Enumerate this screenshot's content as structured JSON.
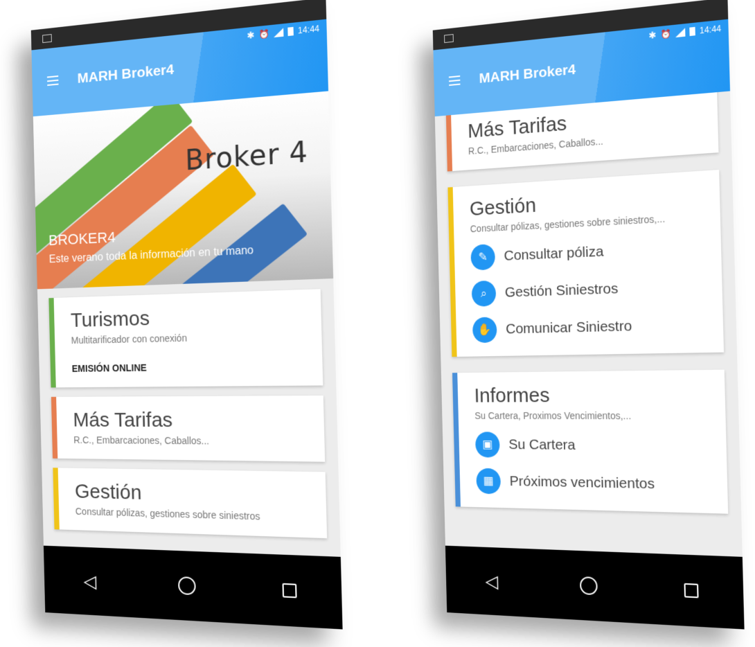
{
  "app": {
    "title": "MARH Broker4",
    "time": "14:44"
  },
  "colors": {
    "appbar": "#64b5f6",
    "green": "#6ab04c",
    "orange": "#e67e50",
    "yellow": "#f0c419",
    "blue": "#4a90d9",
    "icon_circle": "#2196f3"
  },
  "hero": {
    "brand": "Broker 4",
    "title": "BROKER4",
    "subtitle": "Este verano toda la información en tu mano"
  },
  "cards": {
    "turismos": {
      "title": "Turismos",
      "subtitle": "Multitarificador con conexión",
      "action": "EMISIÓN ONLINE"
    },
    "mas_tarifas": {
      "title": "Más Tarifas",
      "subtitle": "R.C., Embarcaciones, Caballos..."
    },
    "gestion": {
      "title": "Gestión",
      "subtitle_full": "Consultar pólizas, gestiones sobre siniestros,...",
      "subtitle_cut": "Consultar pólizas, gestiones sobre siniestros",
      "items": [
        {
          "label": "Consultar póliza",
          "icon": "edit-document-icon"
        },
        {
          "label": "Gestión Siniestros",
          "icon": "search-document-icon"
        },
        {
          "label": "Comunicar Siniestro",
          "icon": "hand-report-icon"
        }
      ]
    },
    "informes": {
      "title": "Informes",
      "subtitle": "Su Cartera, Proximos Vencimientos,...",
      "items": [
        {
          "label": "Su Cartera",
          "icon": "wallet-icon"
        },
        {
          "label": "Próximos vencimientos",
          "icon": "calendar-clock-icon"
        }
      ]
    }
  },
  "nav": {
    "back": "◁",
    "home": "○",
    "recents": "□"
  }
}
